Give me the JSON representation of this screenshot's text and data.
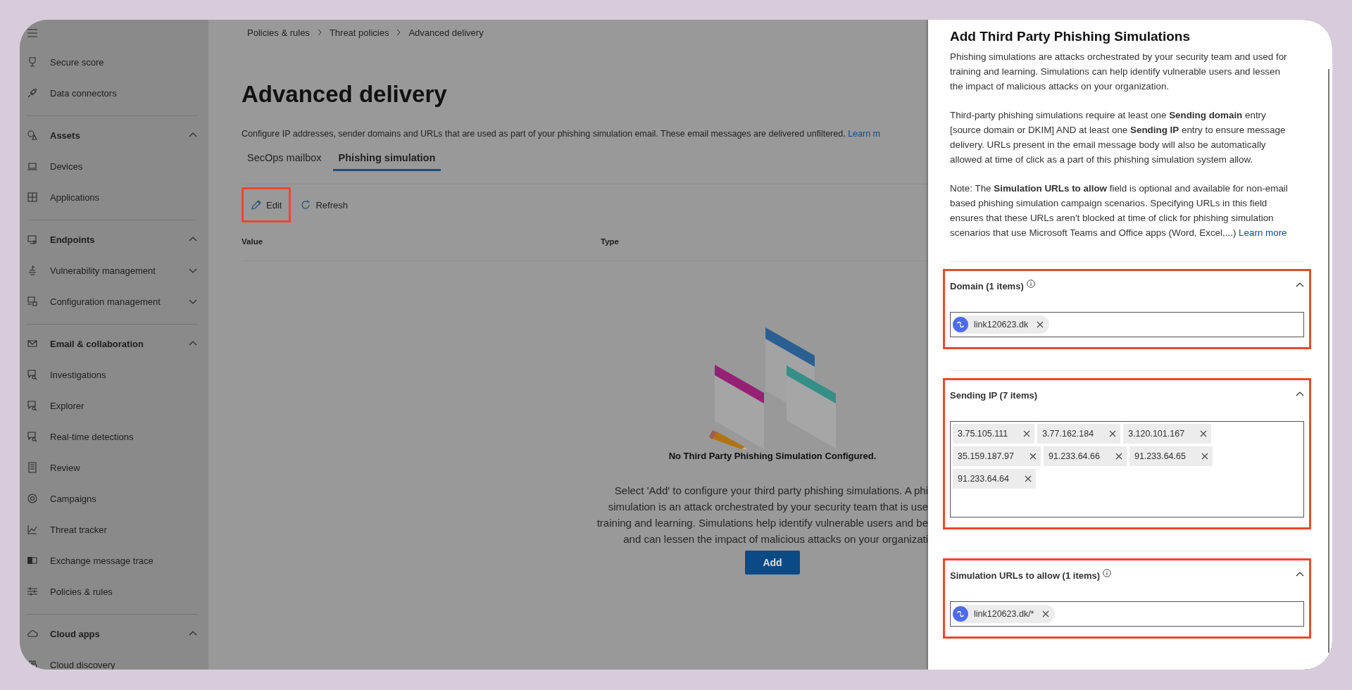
{
  "sidebar": {
    "items": [
      {
        "label": "Secure score"
      },
      {
        "label": "Data connectors"
      },
      {
        "label": "Assets",
        "expanded": true,
        "children": [
          {
            "label": "Devices"
          },
          {
            "label": "Applications"
          }
        ]
      },
      {
        "label": "Endpoints",
        "expanded": true,
        "children": [
          {
            "label": "Vulnerability management",
            "expanded": false
          },
          {
            "label": "Configuration management",
            "expanded": false
          }
        ]
      },
      {
        "label": "Email & collaboration",
        "expanded": true,
        "children": [
          {
            "label": "Investigations"
          },
          {
            "label": "Explorer"
          },
          {
            "label": "Real-time detections"
          },
          {
            "label": "Review"
          },
          {
            "label": "Campaigns"
          },
          {
            "label": "Threat tracker"
          },
          {
            "label": "Exchange message trace"
          },
          {
            "label": "Policies & rules"
          }
        ]
      },
      {
        "label": "Cloud apps",
        "expanded": true,
        "children": [
          {
            "label": "Cloud discovery"
          }
        ]
      }
    ]
  },
  "breadcrumb": [
    "Policies & rules",
    "Threat policies",
    "Advanced delivery"
  ],
  "page": {
    "title": "Advanced delivery",
    "description": "Configure IP addresses, sender domains and URLs that are used as part of your phishing simulation email. These email messages are delivered unfiltered.",
    "description_link": "Learn m"
  },
  "tabs": [
    {
      "label": "SecOps mailbox",
      "selected": false
    },
    {
      "label": "Phishing simulation",
      "selected": true
    }
  ],
  "toolbar": [
    {
      "label": "Edit",
      "kind": "edit",
      "highlighted": true
    },
    {
      "label": "Refresh",
      "kind": "refresh",
      "highlighted": false
    }
  ],
  "table": {
    "columns": [
      "Value",
      "Type"
    ]
  },
  "empty_state": {
    "heading": "No Third Party Phishing Simulation Configured.",
    "lines": [
      "Select 'Add' to configure your third party phishing simulations. A phi",
      "simulation is an attack orchestrated by your security team that is use",
      "training and learning. Simulations help identify vulnerable users and be",
      "and can lessen the impact of malicious attacks on your organizati"
    ],
    "button": "Add"
  },
  "panel": {
    "title": "Add Third Party Phishing Simulations",
    "paragraphs": [
      {
        "text": "Phishing simulations are attacks orchestrated by your security team and used for training and learning. Simulations can help identify vulnerable users and lessen the impact of malicious attacks on your organization."
      },
      {
        "text": "Third-party phishing simulations require at least one **Sending domain** entry [source domain or DKIM] AND at least one **Sending IP** entry to ensure message delivery. URLs present in the email message body will also be automatically allowed at time of click as a part of this phishing simulation system allow."
      },
      {
        "text": "Note: The **Simulation URLs to allow** field is optional and available for non-email based phishing simulation campaign scenarios. Specifying URLs in this field ensures that these URLs aren't blocked at time of click for phishing simulation scenarios that use Microsoft Teams and Office apps (Word, Excel,...)",
        "link": "Learn more"
      }
    ],
    "sections": [
      {
        "label": "Domain (1 items)",
        "info": true,
        "expanded": true,
        "highlighted": true,
        "kind": "short",
        "chips": [
          {
            "text": "link120623.dk",
            "kind": "linked"
          }
        ]
      },
      {
        "label": "Sending IP (7 items)",
        "info": false,
        "expanded": true,
        "highlighted": true,
        "kind": "tall",
        "chips": [
          {
            "text": "3.75.105.111",
            "kind": "plain"
          },
          {
            "text": "3.77.162.184",
            "kind": "plain"
          },
          {
            "text": "3.120.101.167",
            "kind": "plain"
          },
          {
            "text": "35.159.187.97",
            "kind": "plain"
          },
          {
            "text": "91.233.64.66",
            "kind": "plain"
          },
          {
            "text": "91.233.64.65",
            "kind": "plain"
          },
          {
            "text": "91.233.64.64",
            "kind": "plain"
          }
        ]
      },
      {
        "label": "Simulation URLs to allow (1 items)",
        "info": true,
        "expanded": true,
        "highlighted": true,
        "kind": "short",
        "chips": [
          {
            "text": "link120623.dk/*",
            "kind": "linked"
          }
        ]
      }
    ]
  }
}
